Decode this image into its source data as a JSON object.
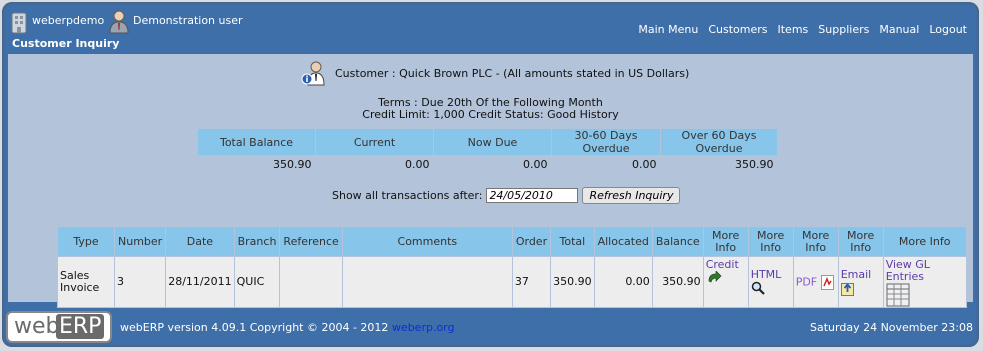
{
  "header": {
    "company": "weberpdemo",
    "user": "Demonstration user",
    "page_title": "Customer Inquiry",
    "nav": [
      "Main Menu",
      "Customers",
      "Items",
      "Suppliers",
      "Manual",
      "Logout"
    ]
  },
  "customer": {
    "title": "Customer : Quick Brown PLC - (All amounts stated in US Dollars)",
    "terms": "Terms : Due 20th Of the Following Month",
    "credit": "Credit Limit: 1,000 Credit Status: Good History"
  },
  "summary": {
    "headers": [
      "Total Balance",
      "Current",
      "Now Due",
      "30-60 Days Overdue",
      "Over 60 Days Overdue"
    ],
    "values": [
      "350.90",
      "0.00",
      "0.00",
      "0.00",
      "350.90"
    ]
  },
  "filter": {
    "label": "Show all transactions after:",
    "date_value": "24/05/2010",
    "button": "Refresh Inquiry"
  },
  "transactions": {
    "headers": [
      "Type",
      "Number",
      "Date",
      "Branch",
      "Reference",
      "Comments",
      "Order",
      "Total",
      "Allocated",
      "Balance",
      "More Info",
      "More Info",
      "More Info",
      "More Info",
      "More Info"
    ],
    "rows": [
      {
        "type": "Sales Invoice",
        "number": "3",
        "date": "28/11/2011",
        "branch": "QUIC",
        "reference": "",
        "comments": "",
        "order": "37",
        "total": "350.90",
        "allocated": "0.00",
        "balance": "350.90",
        "credit_link": "Credit",
        "html_link": "HTML",
        "pdf_link": "PDF",
        "email_link": "Email",
        "gl_link": "View GL Entries"
      }
    ]
  },
  "footer": {
    "logo_a": "web",
    "logo_b": "ERP",
    "copyright": "webERP version 4.09.1 Copyright © 2004 - 2012",
    "site": "weberp.org",
    "datetime": "Saturday 24 November 23:08"
  },
  "colors": {
    "frame": "#3f6fa8",
    "content_bg": "#b3c3d9",
    "table_header": "#87c5ea",
    "row_bg": "#ededed",
    "link": "#5a3ca8"
  }
}
